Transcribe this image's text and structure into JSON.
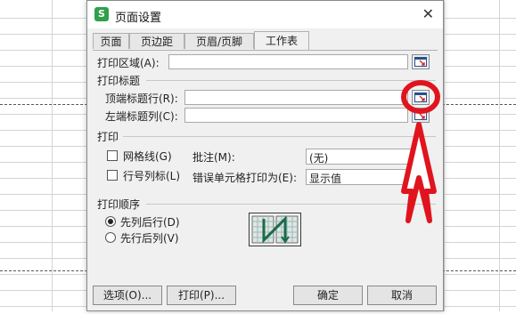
{
  "window": {
    "title": "页面设置",
    "app_icon_letter": "S",
    "close_glyph": "✕"
  },
  "tabs": [
    {
      "label": "页面",
      "active": false
    },
    {
      "label": "页边距",
      "active": false
    },
    {
      "label": "页眉/页脚",
      "active": false
    },
    {
      "label": "工作表",
      "active": true
    }
  ],
  "print_area": {
    "label": "打印区域(A):",
    "value": ""
  },
  "print_titles": {
    "group_label": "打印标题",
    "top_rows": {
      "label": "顶端标题行(R):",
      "value": ""
    },
    "left_cols": {
      "label": "左端标题列(C):",
      "value": ""
    }
  },
  "print": {
    "group_label": "打印",
    "gridlines": {
      "label": "网格线(G)",
      "checked": false
    },
    "row_col_headers": {
      "label": "行号列标(L)",
      "checked": false
    },
    "comments": {
      "label": "批注(M):",
      "value": "(无)"
    },
    "cell_errors": {
      "label": "错误单元格打印为(E):",
      "value": "显示值"
    }
  },
  "page_order": {
    "group_label": "打印顺序",
    "down_then_over": {
      "label": "先列后行(D)",
      "selected": true
    },
    "over_then_down": {
      "label": "先行后列(V)",
      "selected": false
    }
  },
  "buttons": {
    "options": "选项(O)...",
    "print": "打印(P)...",
    "ok": "确定",
    "cancel": "取消"
  },
  "annotation_color": "#e0141e",
  "accent_color": "#2ea04a"
}
